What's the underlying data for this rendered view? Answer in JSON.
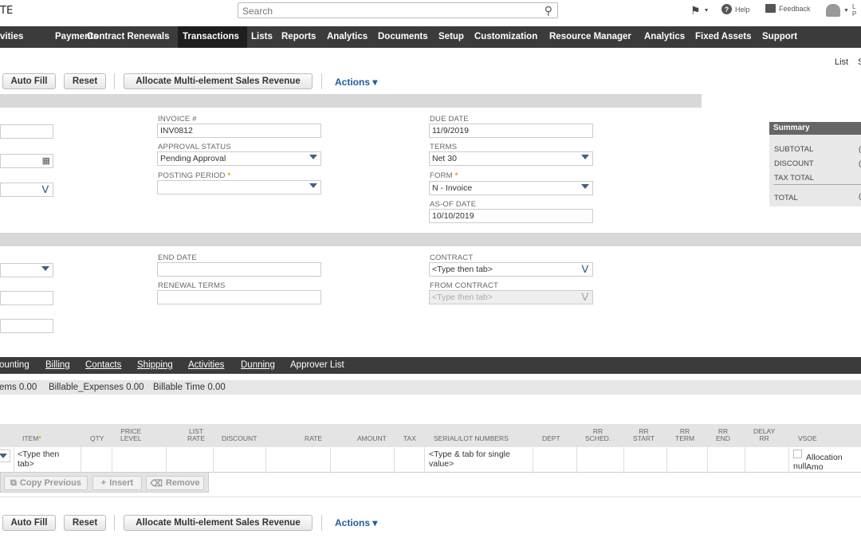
{
  "header": {
    "logo_text": "TE",
    "search_placeholder": "Search",
    "help": "Help",
    "feedback": "Feedback",
    "user_line1": "L",
    "user_line2": "P"
  },
  "nav": {
    "items": [
      "vities",
      "Payments",
      "Contract Renewals",
      "Transactions",
      "Lists",
      "Reports",
      "Analytics",
      "Documents",
      "Setup",
      "Customization",
      "Resource Manager",
      "Analytics",
      "Fixed Assets",
      "Support"
    ],
    "active": "Transactions"
  },
  "top_right": {
    "list": "List",
    "more": "S"
  },
  "toolbar": {
    "auto_fill": "Auto Fill",
    "reset": "Reset",
    "allocate": "Allocate Multi-element Sales Revenue",
    "actions": "Actions ▾"
  },
  "primary": {
    "invoice_label": "INVOICE #",
    "invoice_value": "INV0812",
    "approval_label": "APPROVAL STATUS",
    "approval_value": "Pending Approval",
    "posting_label": "POSTING PERIOD",
    "due_label": "DUE DATE",
    "due_value": "11/9/2019",
    "terms_label": "TERMS",
    "terms_value": "Net 30",
    "form_label": "FORM",
    "form_value": "N - Invoice",
    "asof_label": "AS-OF DATE",
    "asof_value": "10/10/2019",
    "required_mark": "*"
  },
  "summary": {
    "title": "Summary",
    "subtotal": "SUBTOTAL",
    "discount": "DISCOUNT",
    "tax_total": "TAX TOTAL",
    "total": "TOTAL",
    "subtotal_value": "(",
    "discount_value": "(",
    "total_value": "("
  },
  "contract_section": {
    "end_date_label": "END DATE",
    "renewal_terms_label": "RENEWAL TERMS",
    "contract_label": "CONTRACT",
    "contract_placeholder": "<Type then tab>",
    "from_contract_label": "FROM CONTRACT",
    "from_contract_placeholder": "<Type then tab>"
  },
  "subtabs": [
    "ounting",
    "Billing",
    "Contacts",
    "Shipping",
    "Activities",
    "Dunning",
    "Approver List"
  ],
  "subinfo": {
    "items": "ems 0.00",
    "expenses": "Billable_Expenses 0.00",
    "time": "Billable Time 0.00"
  },
  "table": {
    "headers": {
      "item": "ITEM",
      "qty": "QTY",
      "price_level_1": "PRICE",
      "price_level_2": "LEVEL",
      "list_rate_1": "LIST",
      "list_rate_2": "RATE",
      "discount": "DISCOUNT",
      "rate": "RATE",
      "amount": "AMOUNT",
      "tax": "TAX",
      "serial": "SERIAL/LOT NUMBERS",
      "dept": "DEPT",
      "rr_sched_1": "RR",
      "rr_sched_2": "SCHED.",
      "rr_start_1": "RR",
      "rr_start_2": "START",
      "rr_term_1": "RR",
      "rr_term_2": "TERM",
      "rr_end_1": "RR",
      "rr_end_2": "END",
      "delay_rr_1": "DELAY",
      "delay_rr_2": "RR",
      "vsoe": "VSOE"
    },
    "row": {
      "item_1": "<Type then",
      "item_2": "tab>",
      "serial_1": "<Type & tab for single",
      "serial_2": "value>",
      "alloc_1": "Allocation Amo",
      "alloc_2": "null"
    },
    "buttons": {
      "copy_previous": "Copy Previous",
      "insert": "Insert",
      "remove": "Remove"
    }
  }
}
